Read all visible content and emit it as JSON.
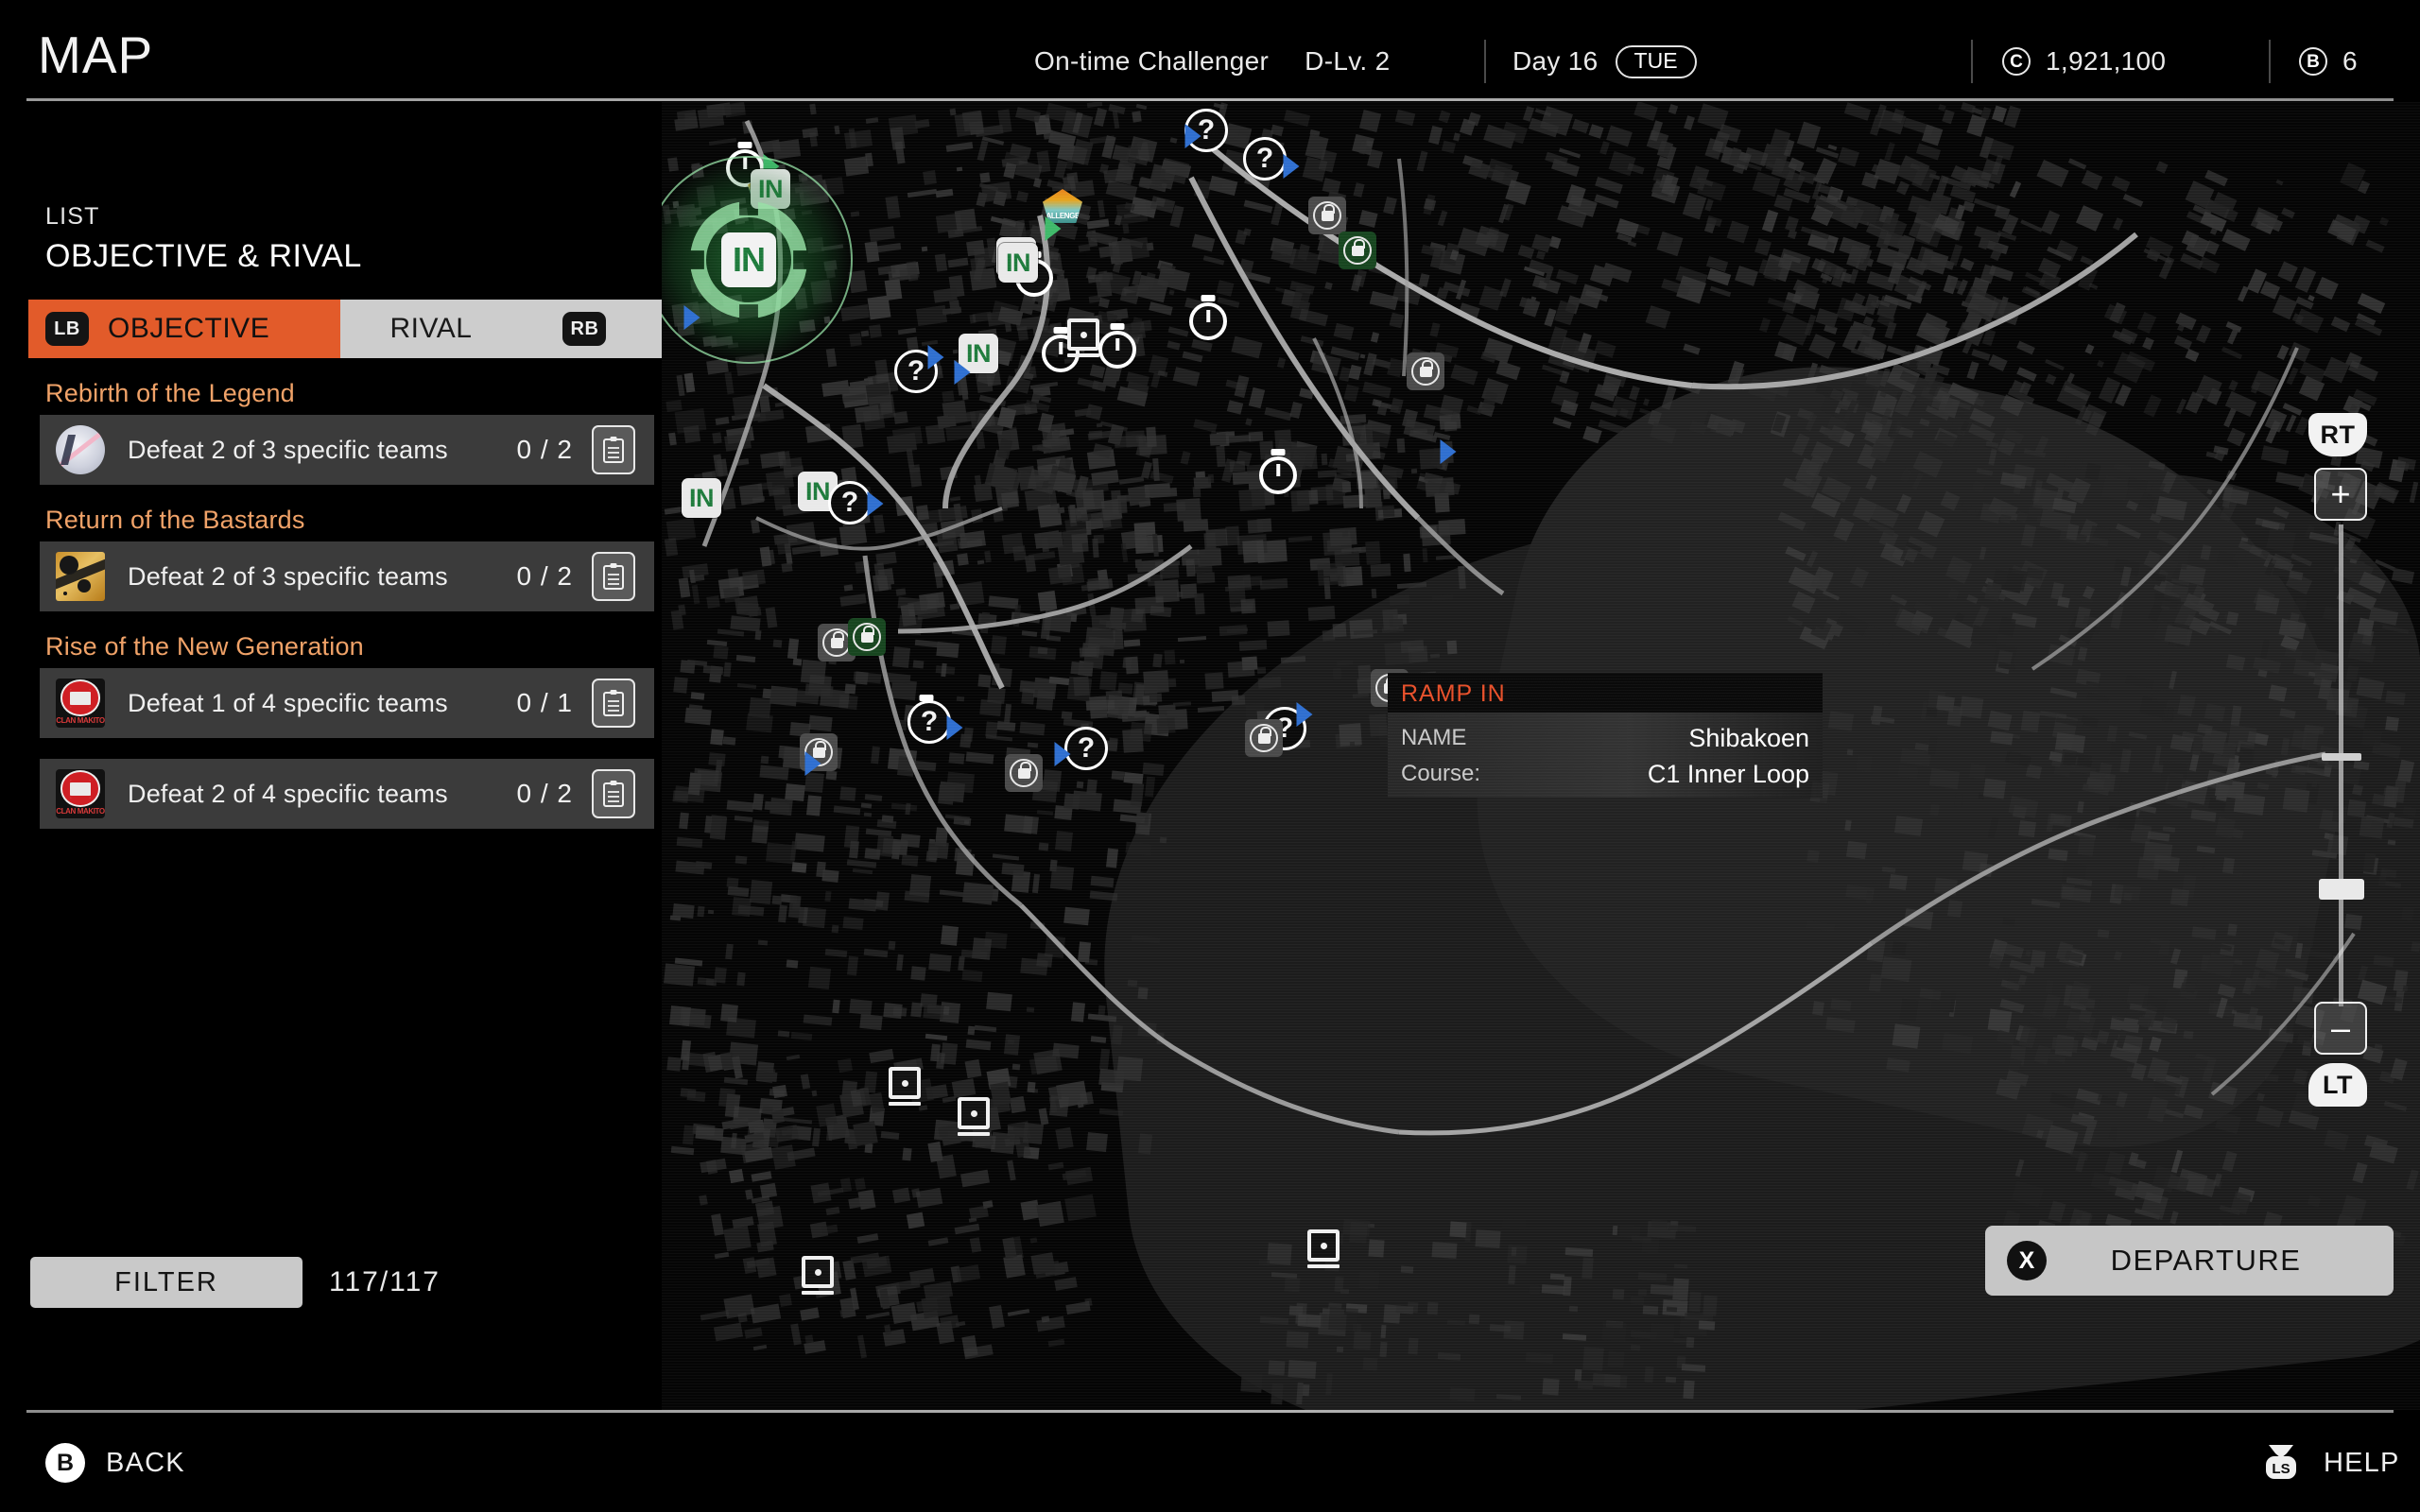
{
  "header": {
    "title": "MAP",
    "status_label": "On-time Challenger",
    "difficulty": "D-Lv. 2",
    "day": "Day 16",
    "weekday": "TUE",
    "credits_icon": "C",
    "credits": "1,921,100",
    "bp_icon": "B",
    "bp": "6"
  },
  "sidebar": {
    "kicker": "LIST",
    "title": "OBJECTIVE & RIVAL",
    "tabs": [
      {
        "label": "OBJECTIVE",
        "bumper": "LB",
        "selected": true
      },
      {
        "label": "RIVAL",
        "bumper": "RB",
        "selected": false
      }
    ],
    "groups": [
      {
        "title": "Rebirth of the Legend",
        "emblem": "legend-emblem",
        "rows": [
          {
            "text": "Defeat 2 of 3 specific teams",
            "count": "0 / 2",
            "action_icon": "clipboard-icon"
          }
        ]
      },
      {
        "title": "Return of the Bastards",
        "emblem": "bastards-emblem",
        "rows": [
          {
            "text": "Defeat 2 of 3 specific teams",
            "count": "0 / 2",
            "action_icon": "clipboard-icon"
          }
        ]
      },
      {
        "title": "Rise of the New Generation",
        "emblem": "makito-emblem",
        "emblem_name": "CLAN MAKITO",
        "rows": [
          {
            "text": "Defeat 1 of 4 specific teams",
            "count": "0 / 1",
            "action_icon": "clipboard-icon"
          },
          {
            "text": "Defeat 2 of 4 specific teams",
            "count": "0 / 2",
            "action_icon": "clipboard-icon"
          }
        ]
      }
    ],
    "filter": {
      "label": "FILTER",
      "count": "117/117"
    }
  },
  "info_panel": {
    "type": "RAMP IN",
    "rows": [
      {
        "key": "NAME",
        "value": "Shibakoen"
      },
      {
        "key": "Course:",
        "value": "C1 Inner Loop"
      }
    ]
  },
  "map_controls": {
    "zoom_in": "+",
    "zoom_out": "–",
    "trigger_up": "RT",
    "trigger_down": "LT"
  },
  "departure": {
    "badge": "X",
    "label": "DEPARTURE"
  },
  "footer": {
    "back": {
      "badge": "B",
      "label": "BACK"
    },
    "help": {
      "badge": "LS",
      "label": "HELP"
    }
  },
  "map_markers": {
    "in_label": "IN",
    "question_label": "?",
    "team_label": "CHALLENGERS"
  },
  "colors": {
    "accent_orange": "#e25b2a",
    "group_title": "#f0a268",
    "marker_green": "#1e7b3c",
    "arrow_blue": "#2f6fd0",
    "panel_header_red": "#e8502a"
  }
}
